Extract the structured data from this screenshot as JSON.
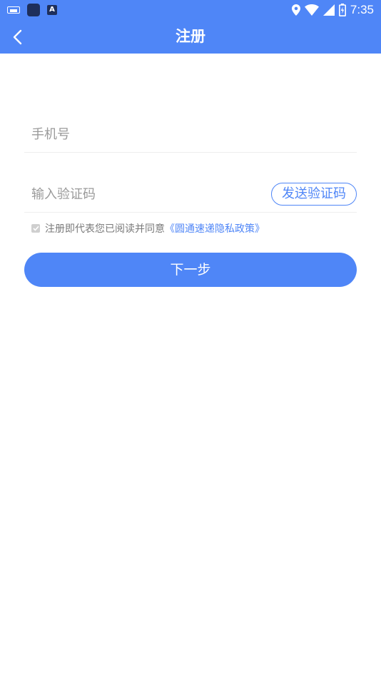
{
  "status_bar": {
    "time": "7:35",
    "left_icons": [
      "keyboard-icon",
      "app-icon",
      "a-icon"
    ],
    "right_icons": [
      "location-icon",
      "wifi-icon",
      "signal-icon",
      "battery-icon"
    ]
  },
  "header": {
    "title": "注册",
    "back_icon": "chevron-left-icon",
    "background": "#4f86f7"
  },
  "form": {
    "phone": {
      "placeholder": "手机号",
      "value": ""
    },
    "code": {
      "placeholder": "输入验证码",
      "value": ""
    },
    "send_code_label": "发送验证码"
  },
  "agreement": {
    "checked": true,
    "text": "注册即代表您已阅读并同意",
    "link_text": "《圆通速递隐私政策》"
  },
  "next_button": {
    "label": "下一步"
  },
  "colors": {
    "accent": "#4f86f7",
    "placeholder": "#9a9a9a",
    "agreement_text": "#7a7a7a"
  }
}
